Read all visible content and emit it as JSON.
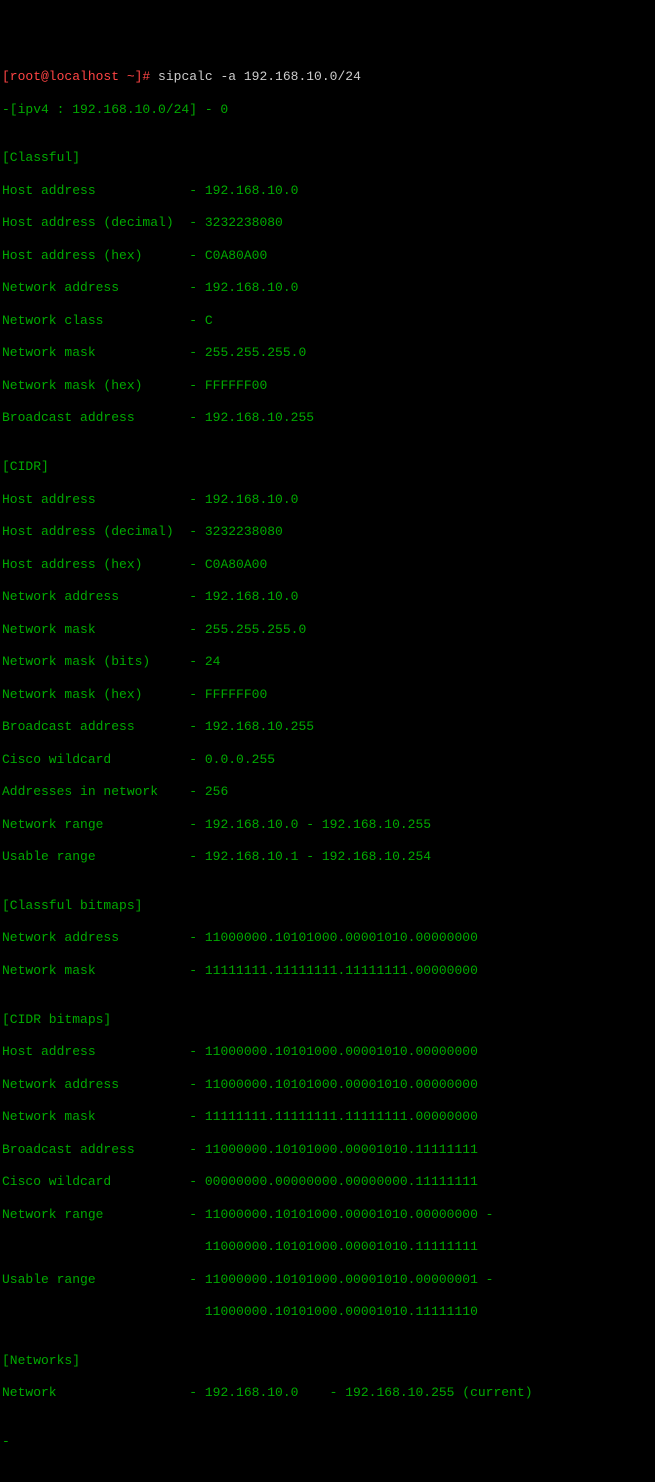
{
  "prompt": {
    "user_host": "[root@localhost ~]#",
    "command": " sipcalc -a 192.168.10.0/24"
  },
  "header": "-[ipv4 : 192.168.10.0/24] - 0",
  "blank": "",
  "classful": {
    "title": "[Classful]",
    "rows": [
      {
        "label": "Host address            ",
        "value": "- 192.168.10.0"
      },
      {
        "label": "Host address (decimal)  ",
        "value": "- 3232238080"
      },
      {
        "label": "Host address (hex)      ",
        "value": "- C0A80A00"
      },
      {
        "label": "Network address         ",
        "value": "- 192.168.10.0"
      },
      {
        "label": "Network class           ",
        "value": "- C"
      },
      {
        "label": "Network mask            ",
        "value": "- 255.255.255.0"
      },
      {
        "label": "Network mask (hex)      ",
        "value": "- FFFFFF00"
      },
      {
        "label": "Broadcast address       ",
        "value": "- 192.168.10.255"
      }
    ]
  },
  "cidr": {
    "title": "[CIDR]",
    "rows": [
      {
        "label": "Host address            ",
        "value": "- 192.168.10.0"
      },
      {
        "label": "Host address (decimal)  ",
        "value": "- 3232238080"
      },
      {
        "label": "Host address (hex)      ",
        "value": "- C0A80A00"
      },
      {
        "label": "Network address         ",
        "value": "- 192.168.10.0"
      },
      {
        "label": "Network mask            ",
        "value": "- 255.255.255.0"
      },
      {
        "label": "Network mask (bits)     ",
        "value": "- 24"
      },
      {
        "label": "Network mask (hex)      ",
        "value": "- FFFFFF00"
      },
      {
        "label": "Broadcast address       ",
        "value": "- 192.168.10.255"
      },
      {
        "label": "Cisco wildcard          ",
        "value": "- 0.0.0.255"
      },
      {
        "label": "Addresses in network    ",
        "value": "- 256"
      },
      {
        "label": "Network range           ",
        "value": "- 192.168.10.0 - 192.168.10.255"
      },
      {
        "label": "Usable range            ",
        "value": "- 192.168.10.1 - 192.168.10.254"
      }
    ]
  },
  "classful_bitmaps": {
    "title": "[Classful bitmaps]",
    "rows": [
      {
        "label": "Network address         ",
        "value": "- 11000000.10101000.00001010.00000000"
      },
      {
        "label": "Network mask            ",
        "value": "- 11111111.11111111.11111111.00000000"
      }
    ]
  },
  "cidr_bitmaps": {
    "title": "[CIDR bitmaps]",
    "rows": [
      {
        "label": "Host address            ",
        "value": "- 11000000.10101000.00001010.00000000"
      },
      {
        "label": "Network address         ",
        "value": "- 11000000.10101000.00001010.00000000"
      },
      {
        "label": "Network mask            ",
        "value": "- 11111111.11111111.11111111.00000000"
      },
      {
        "label": "Broadcast address       ",
        "value": "- 11000000.10101000.00001010.11111111"
      },
      {
        "label": "Cisco wildcard          ",
        "value": "- 00000000.00000000.00000000.11111111"
      },
      {
        "label": "Network range           ",
        "value": "- 11000000.10101000.00001010.00000000 -"
      },
      {
        "label": "                          ",
        "value": "11000000.10101000.00001010.11111111"
      },
      {
        "label": "Usable range            ",
        "value": "- 11000000.10101000.00001010.00000001 -"
      },
      {
        "label": "                          ",
        "value": "11000000.10101000.00001010.11111110"
      }
    ]
  },
  "networks": {
    "title": "[Networks]",
    "rows": [
      {
        "label": "Network                 ",
        "value": "- 192.168.10.0    - 192.168.10.255 (current)"
      }
    ]
  },
  "trailing_dash": "-"
}
